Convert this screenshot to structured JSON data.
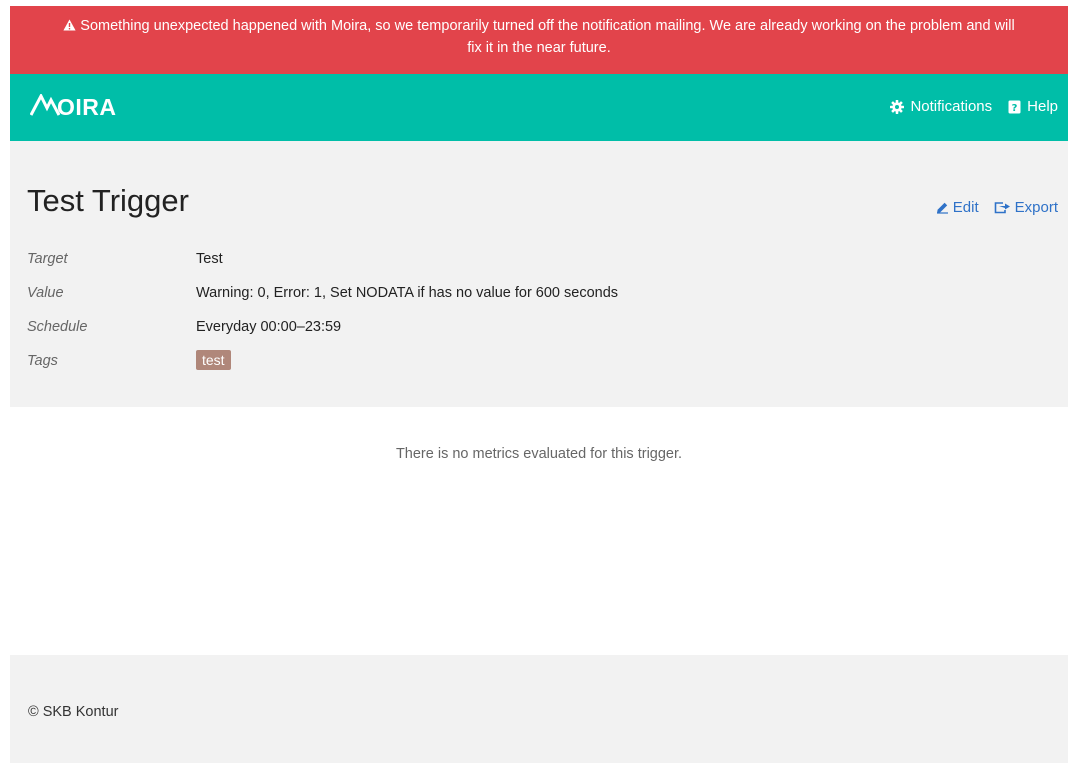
{
  "alert": {
    "icon": "warning-icon",
    "line1": "Something unexpected happened with Moira, so we temporarily turned off the notification mailing. We are already working on the problem and will",
    "line2": "fix it in the near future.",
    "color": "#e2444b"
  },
  "header": {
    "logo_text": "OIRA",
    "logo_mark": "M",
    "brand_color": "#00bea8",
    "nav": {
      "notifications_label": "Notifications",
      "notifications_icon": "gear-icon",
      "help_label": "Help",
      "help_icon": "help-icon"
    }
  },
  "trigger": {
    "title": "Test Trigger",
    "actions": {
      "edit_label": "Edit",
      "edit_icon": "pencil-icon",
      "export_label": "Export",
      "export_icon": "export-icon",
      "link_color": "#2f72c8"
    },
    "fields": [
      {
        "label": "Target",
        "value": "Test"
      },
      {
        "label": "Value",
        "value": "Warning: 0, Error: 1, Set NODATA if has no value for 600 seconds"
      },
      {
        "label": "Schedule",
        "value": "Everyday 00:00–23:59"
      },
      {
        "label": "Tags",
        "value": ""
      }
    ],
    "tags": [
      "test"
    ],
    "tag_color": "#b0877a"
  },
  "metrics": {
    "empty_message": "There is no metrics evaluated for this trigger."
  },
  "footer": {
    "copyright": "© SKB Kontur"
  }
}
